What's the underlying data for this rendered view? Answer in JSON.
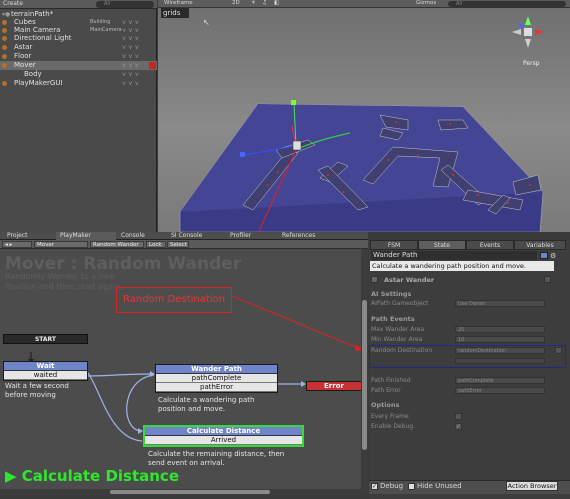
{
  "hierarchy": {
    "create_label": "Create",
    "search_placeholder": "All",
    "items": [
      {
        "label": "terrainPath*",
        "tag": ""
      },
      {
        "label": "Cubes",
        "tag": "Building"
      },
      {
        "label": "Main Camera",
        "tag": "MainCamera"
      },
      {
        "label": "Directional Light",
        "tag": ""
      },
      {
        "label": "Astar",
        "tag": ""
      },
      {
        "label": "Floor",
        "tag": ""
      },
      {
        "label": "Mover",
        "tag": ""
      },
      {
        "label": "Body",
        "tag": ""
      },
      {
        "label": "PlayMakerGUI",
        "tag": ""
      }
    ]
  },
  "scene": {
    "shading": "Wireframe",
    "mode_2d": "2D",
    "gizmos_label": "Gizmos",
    "search_placeholder": "All",
    "grids_label": "grids",
    "persp_label": "Persp"
  },
  "bottom_tabs": [
    "Project",
    "PlayMaker",
    "Console",
    "SI Console",
    "Profiler",
    "References"
  ],
  "playmaker": {
    "object_dropdown": "Mover",
    "fsm_dropdown": "Random Wander",
    "lock_label": "Lock",
    "select_label": "Select",
    "title": "Mover : Random Wander",
    "description": "Randomly Wander to a new Position and then start again.",
    "start_label": "START",
    "states": {
      "wait": {
        "title": "Wait",
        "events": [
          "waited"
        ],
        "desc": "Wait a few second before moving"
      },
      "wander": {
        "title": "Wander Path",
        "events": [
          "pathComplete",
          "pathError"
        ],
        "desc": "Calculate a wandering path position and move."
      },
      "calc": {
        "title": "Calculate Distance",
        "events": [
          "Arrived"
        ],
        "desc": "Calculate the remaining distance, then send event on arrival."
      },
      "error": {
        "title": "Error"
      }
    },
    "current_state_label": "Calculate Distance",
    "annotation": "Random Destination"
  },
  "inspector": {
    "tabs": [
      "FSM",
      "State",
      "Events",
      "Variables"
    ],
    "state_name": "Wander Path",
    "state_desc": "Calculate a wandering path position and move.",
    "action_title": "Astar Wander",
    "ai_settings_label": "AI Settings",
    "gameobject_label": "AIPath Gameobject",
    "gameobject_value": "Use Owner",
    "path_events_label": "Path Events",
    "max_wander_label": "Max Wander Area",
    "max_wander_value": "20",
    "min_wander_label": "Min Wander Area",
    "min_wander_value": "10",
    "random_dest_label": "Random Destination",
    "random_dest_value": "randomDestination",
    "path_finished_label": "Path Finished",
    "path_finished_value": "pathComplete",
    "path_error_label": "Path Error",
    "path_error_value": "pathError",
    "options_label": "Options",
    "every_frame_label": "Every Frame",
    "enable_debug_label": "Enable Debug",
    "debug_label": "Debug",
    "hide_unused_label": "Hide Unused",
    "action_browser_label": "Action Browser"
  },
  "colors": {
    "state_header": "#6f84c9",
    "error_header": "#c83232",
    "active_border": "#33dd33",
    "annotation_red": "#dd2222",
    "highlight_blue": "#1f2a86"
  }
}
